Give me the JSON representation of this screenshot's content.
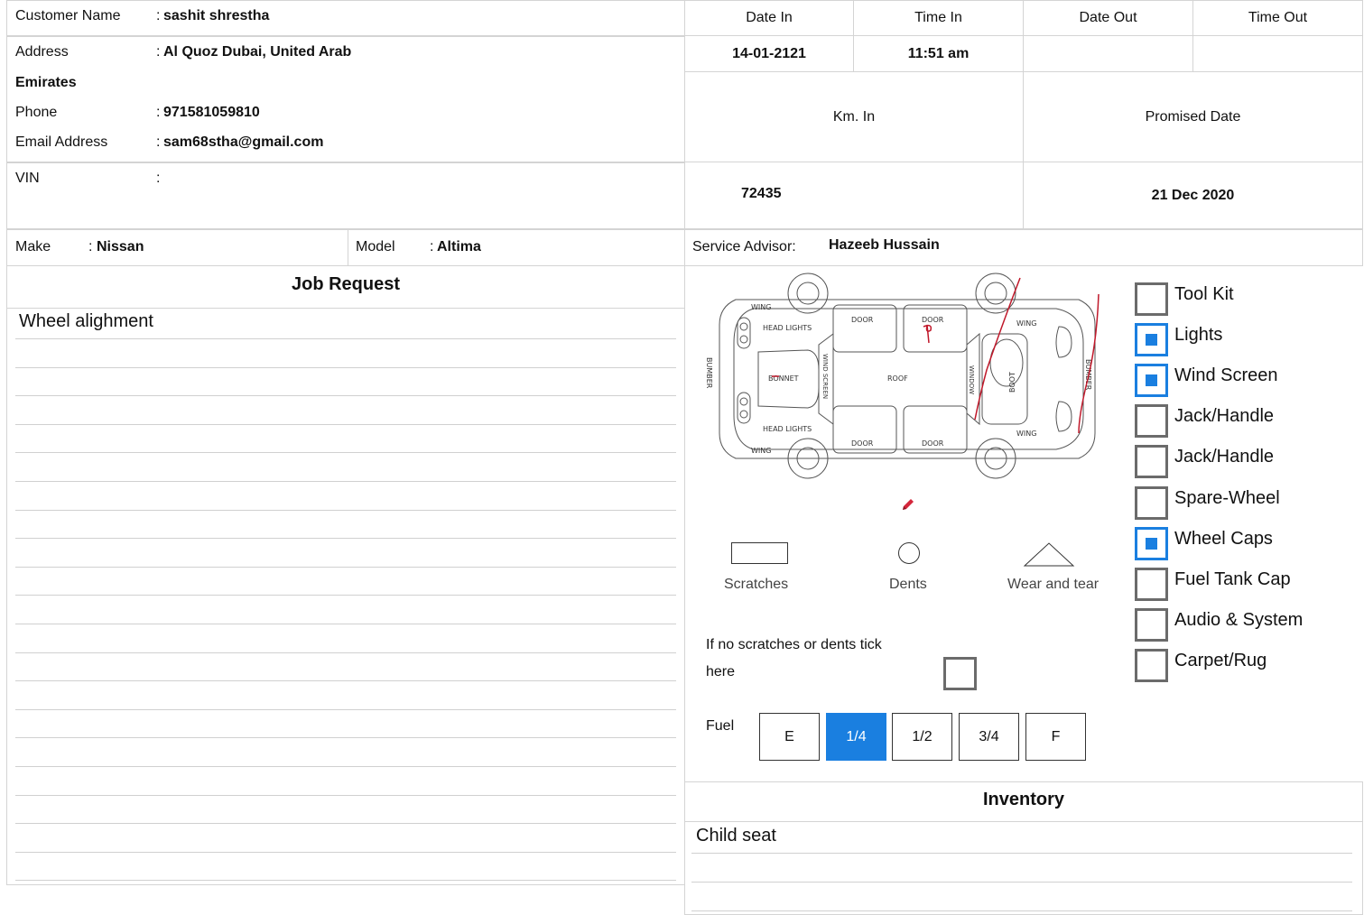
{
  "customer": {
    "name_label": "Customer Name",
    "name_value": "sashit shrestha",
    "address_label": "Address",
    "address_line1": "Al Quoz Dubai, United Arab",
    "address_line2": "Emirates",
    "phone_label": "Phone",
    "phone_value": "971581059810",
    "email_label": "Email Address",
    "email_value": "sam68stha@gmail.com",
    "vin_label": "VIN",
    "vin_value": "",
    "sep": ":"
  },
  "dates": {
    "date_in_label": "Date In",
    "time_in_label": "Time In",
    "date_out_label": "Date Out",
    "time_out_label": "Time Out",
    "date_in": "14-01-2121",
    "time_in": "11:51 am",
    "date_out": "",
    "time_out": "",
    "km_in_label": "Km. In",
    "promised_label": "Promised Date",
    "km_in": "72435",
    "promised": "21 Dec 2020"
  },
  "vehicle": {
    "make_label": "Make",
    "make_value": "Nissan",
    "model_label": "Model",
    "model_value": "Altima",
    "advisor_label": "Service Advisor:",
    "advisor_value": "Hazeeb Hussain"
  },
  "job_request": {
    "title": "Job Request",
    "lines": [
      "Wheel alighment"
    ]
  },
  "diagram": {
    "labels": {
      "wing": "WING",
      "head_lights": "HEAD LIGHTS",
      "door": "DOOR",
      "bonnet": "BONNET",
      "wind_screen": "WIND SCREEN",
      "roof": "ROOF",
      "window": "WINDOW",
      "boot": "BOOT",
      "bumber": "BUMBER"
    },
    "legend": {
      "scratches": "Scratches",
      "dents": "Dents",
      "wear": "Wear and tear"
    },
    "no_damage_line1": "If no scratches or dents tick",
    "no_damage_line2": "here",
    "no_damage_checked": false,
    "annotation_color": "#c0182a"
  },
  "fuel": {
    "label": "Fuel",
    "levels": [
      "E",
      "1/4",
      "1/2",
      "3/4",
      "F"
    ],
    "selected": "1/4",
    "accent": "#1a7fe0"
  },
  "checklist": [
    {
      "label": "Tool Kit",
      "checked": false
    },
    {
      "label": "Lights",
      "checked": true
    },
    {
      "label": "Wind Screen",
      "checked": true
    },
    {
      "label": "Jack/Handle",
      "checked": false
    },
    {
      "label": "Jack/Handle",
      "checked": false
    },
    {
      "label": "Spare-Wheel",
      "checked": false
    },
    {
      "label": "Wheel Caps",
      "checked": true
    },
    {
      "label": "Fuel Tank Cap",
      "checked": false
    },
    {
      "label": "Audio & System",
      "checked": false
    },
    {
      "label": "Carpet/Rug",
      "checked": false
    }
  ],
  "inventory": {
    "title": "Inventory",
    "lines": [
      "Child seat"
    ]
  }
}
